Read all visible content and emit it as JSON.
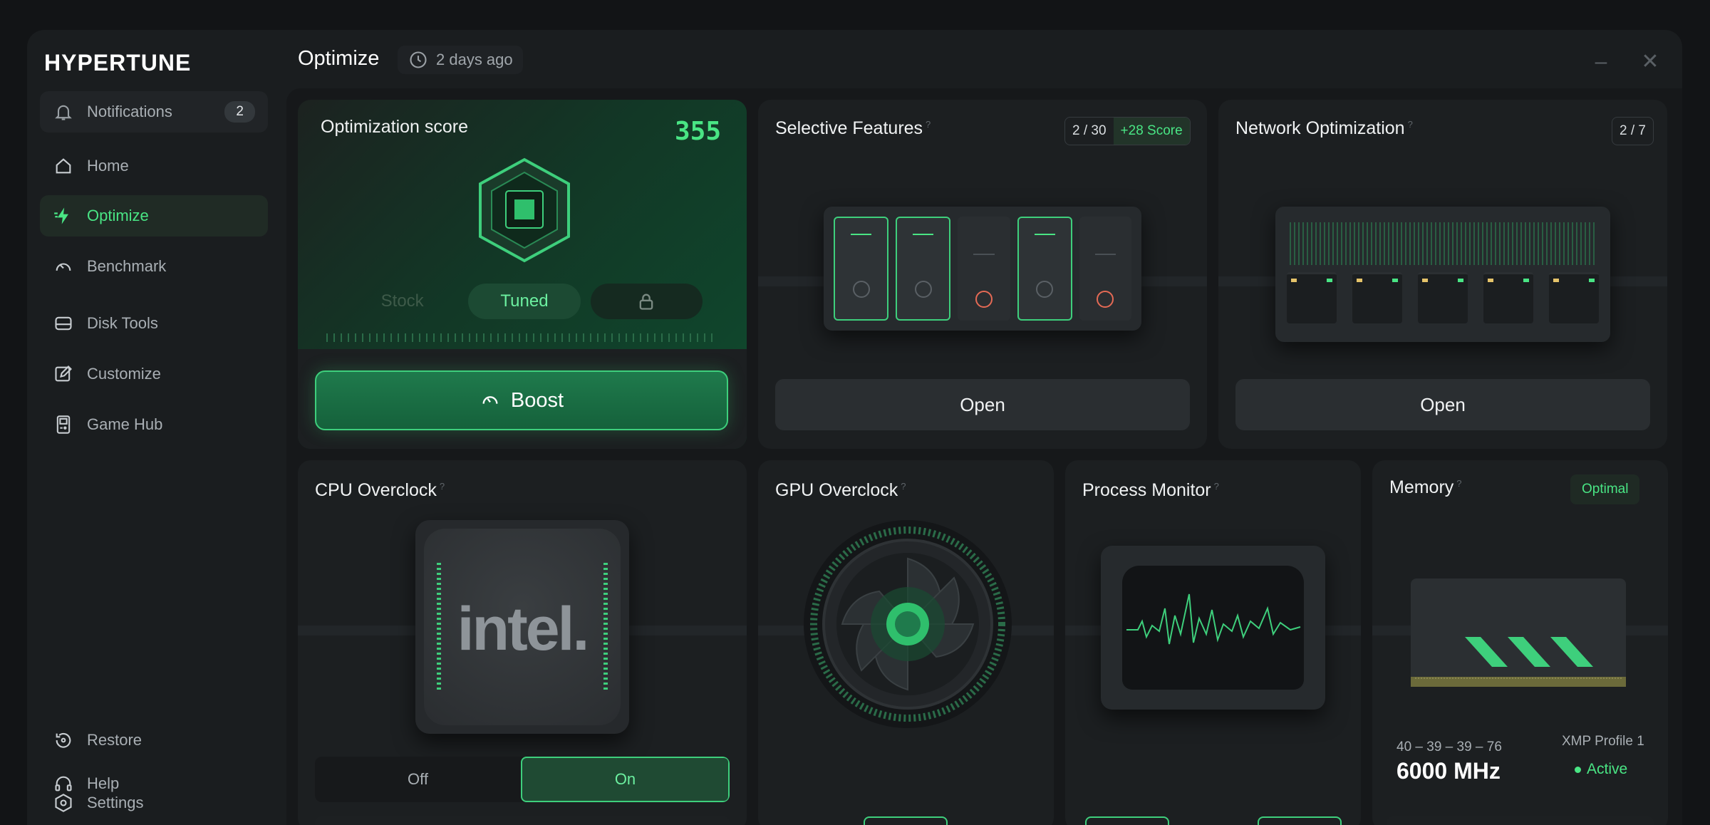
{
  "app": {
    "logo": "HYPERTUNE"
  },
  "sidebar": {
    "notifications": {
      "label": "Notifications",
      "count": "2",
      "icon": "bell-icon"
    },
    "items": [
      {
        "label": "Home",
        "icon": "home-icon",
        "active": false
      },
      {
        "label": "Optimize",
        "icon": "bolt-icon",
        "active": true
      },
      {
        "label": "Benchmark",
        "icon": "gauge-icon",
        "active": false
      },
      {
        "label": "Disk Tools",
        "icon": "drive-icon",
        "active": false
      },
      {
        "label": "Customize",
        "icon": "edit-icon",
        "active": false
      },
      {
        "label": "Game Hub",
        "icon": "gameboy-icon",
        "active": false
      }
    ],
    "footer": [
      {
        "label": "Restore",
        "icon": "restore-icon"
      },
      {
        "label": "Help",
        "icon": "headset-icon"
      },
      {
        "label": "Settings",
        "icon": "hex-gear-icon"
      }
    ]
  },
  "header": {
    "title": "Optimize",
    "last_run": "2 days ago"
  },
  "colors": {
    "accent": "#49e584",
    "background": "#1a1d1f",
    "card": "#1c1f21"
  },
  "score_card": {
    "title": "Optimization score",
    "score": "355",
    "modes": [
      "Stock",
      "Tuned"
    ],
    "selected_mode": "Tuned",
    "locked_mode_icon": "lock-icon",
    "boost_label": "Boost"
  },
  "selective_features": {
    "title": "Selective Features",
    "count": "2 / 30",
    "bonus": "+28 Score",
    "open_label": "Open",
    "switch_states": [
      true,
      true,
      false,
      true,
      false
    ]
  },
  "network": {
    "title": "Network Optimization",
    "count": "2 / 7",
    "open_label": "Open"
  },
  "cpu": {
    "title": "CPU Overclock",
    "brand": "intel.",
    "off_label": "Off",
    "on_label": "On",
    "selected": "On"
  },
  "gpu": {
    "title": "GPU Overclock"
  },
  "process": {
    "title": "Process Monitor"
  },
  "memory": {
    "title": "Memory",
    "status": "Optimal",
    "timings": "40 – 39 – 39 – 76",
    "frequency": "6000 MHz",
    "profile": "XMP Profile 1",
    "profile_status": "Active"
  }
}
